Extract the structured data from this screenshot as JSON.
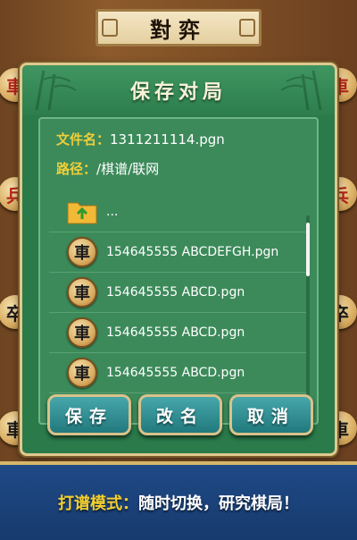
{
  "header": {
    "title": "對弈"
  },
  "side_pieces": {
    "left": [
      "車",
      "兵",
      "卒",
      "車"
    ],
    "right": [
      "車",
      "兵",
      "卒",
      "車"
    ]
  },
  "dialog": {
    "title": "保存对局",
    "filename_label": "文件名：",
    "filename_value": "1311211114.pgn",
    "path_label": "路径：",
    "path_value": "/棋谱/联网",
    "list": {
      "parent_label": "...",
      "files": [
        {
          "icon": "車",
          "name": "154645555 ABCDEFGH.pgn"
        },
        {
          "icon": "車",
          "name": "154645555 ABCD.pgn"
        },
        {
          "icon": "車",
          "name": "154645555 ABCD.pgn"
        },
        {
          "icon": "車",
          "name": "154645555 ABCD.pgn"
        }
      ]
    },
    "buttons": {
      "save": "保存",
      "rename": "改名",
      "cancel": "取消"
    }
  },
  "banner": {
    "label": "打谱模式：",
    "text": "随时切换，研究棋局！"
  },
  "colors": {
    "dialog_green": "#2a7a4a",
    "label_yellow": "#f0cf3a",
    "button_teal": "#2f8f93",
    "banner_blue": "#1f4a86"
  },
  "icons": {
    "folder": "folder-up-icon",
    "file": "chess-piece-ju-icon"
  }
}
